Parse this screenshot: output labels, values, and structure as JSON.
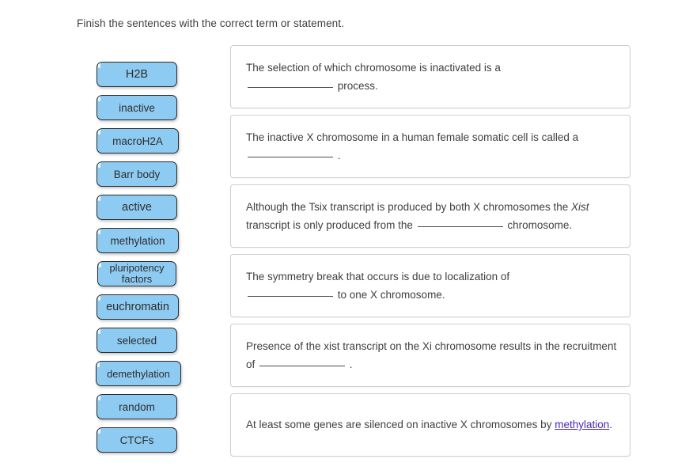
{
  "instruction": "Finish the sentences with the correct term or statement.",
  "terms": [
    {
      "label": "H2B",
      "size": "lg",
      "width": "w102"
    },
    {
      "label": "inactive",
      "size": "md",
      "width": "w102"
    },
    {
      "label": "macroH2A",
      "size": "md",
      "width": "w104"
    },
    {
      "label": "Barr body",
      "size": "md",
      "width": "w102"
    },
    {
      "label": "active",
      "size": "lg",
      "width": "w102"
    },
    {
      "label": "methylation",
      "size": "md",
      "width": "w104"
    },
    {
      "label": "pluripotency factors",
      "size": "sm",
      "width": "w100"
    },
    {
      "label": "euchromatin",
      "size": "lg",
      "width": "w104"
    },
    {
      "label": "selected",
      "size": "md",
      "width": "w102"
    },
    {
      "label": "demethylation",
      "size": "sm",
      "width": "w108"
    },
    {
      "label": "random",
      "size": "md",
      "width": "w102"
    },
    {
      "label": "CTCFs",
      "size": "md",
      "width": "w102"
    }
  ],
  "panels": [
    {
      "id": "panel-random-process",
      "parts": [
        {
          "type": "text",
          "value": "The selection of which chromosome is inactivated is a"
        },
        {
          "type": "break"
        },
        {
          "type": "blank"
        },
        {
          "type": "text",
          "value": " process."
        }
      ]
    },
    {
      "id": "panel-barr-body",
      "parts": [
        {
          "type": "text",
          "value": "The inactive X chromosome in a human female somatic cell is called a"
        },
        {
          "type": "blank"
        },
        {
          "type": "text",
          "value": " ."
        }
      ]
    },
    {
      "id": "panel-xist-inactive",
      "parts": [
        {
          "type": "text",
          "value": "Although the Tsix transcript is produced by both X chromosomes the "
        },
        {
          "type": "italic",
          "value": "Xist"
        },
        {
          "type": "text",
          "value": " transcript is only produced from the "
        },
        {
          "type": "blank"
        },
        {
          "type": "text",
          "value": " chromosome."
        }
      ]
    },
    {
      "id": "panel-pluripotency",
      "parts": [
        {
          "type": "text",
          "value": "The symmetry break that occurs is due to localization of"
        },
        {
          "type": "break"
        },
        {
          "type": "blank"
        },
        {
          "type": "text",
          "value": " to one X chromosome."
        }
      ]
    },
    {
      "id": "panel-recruitment",
      "parts": [
        {
          "type": "text",
          "value": "Presence of the xist transcript on the Xi chromosome results in the recruitment of "
        },
        {
          "type": "blank"
        },
        {
          "type": "text",
          "value": " ."
        }
      ]
    },
    {
      "id": "panel-methylation",
      "parts": [
        {
          "type": "text",
          "value": "At least some genes are silenced on inactive X chromosomes by "
        },
        {
          "type": "answer",
          "value": "methylation"
        },
        {
          "type": "text",
          "value": "."
        }
      ]
    }
  ],
  "colors": {
    "chip_fill": "#8ecbf2",
    "chip_border": "#2a2a2a",
    "panel_border": "#cfcfcf",
    "text": "#3f3f3f",
    "answer_link": "#4b27b5",
    "background": "#ffffff"
  }
}
